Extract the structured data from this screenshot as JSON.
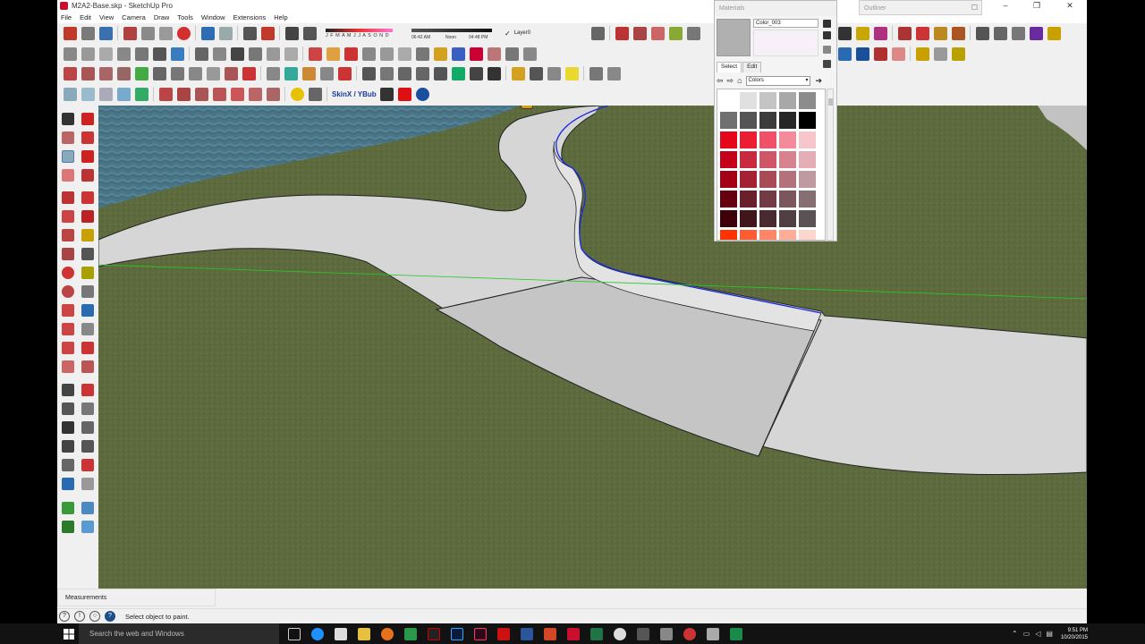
{
  "window": {
    "title": "M2A2-Base.skp - SketchUp Pro",
    "controls": [
      "–",
      "❐",
      "✕"
    ]
  },
  "menu": [
    "File",
    "Edit",
    "View",
    "Camera",
    "Draw",
    "Tools",
    "Window",
    "Extensions",
    "Help"
  ],
  "shadow_settings": {
    "months": "J F M A M J J A S O N D",
    "time_start": "06:42 AM",
    "time_noon": "Noon",
    "time_end": "04:48 PM"
  },
  "layer": {
    "current": "Layer0"
  },
  "extensions_toolbar": {
    "label": "SkinX / YBub"
  },
  "materials_panel": {
    "title": "Materials",
    "material_name": "Color_003",
    "tabs": [
      "Select",
      "Edit"
    ],
    "library": "Colors",
    "swatch_color": "#b0b0b0",
    "swatches": [
      "#ffffff",
      "#e0e0e0",
      "#c4c4c4",
      "#a8a8a8",
      "#8c8c8c",
      "#707070",
      "#555555",
      "#3c3c3c",
      "#262626",
      "#000000",
      "#e5061b",
      "#ec1c33",
      "#f05068",
      "#f58a9a",
      "#f9c5cd",
      "#c4001a",
      "#c9293f",
      "#d05568",
      "#d8828f",
      "#e3aeb6",
      "#a30015",
      "#a52233",
      "#ab4a57",
      "#b3727b",
      "#bf9aa0",
      "#660011",
      "#6b1f2b",
      "#733b44",
      "#7b575d",
      "#856f72",
      "#3d000b",
      "#42141b",
      "#492a30",
      "#513e42",
      "#5a5254",
      "#ff3300",
      "#ff5c33",
      "#ff8566",
      "#ffad99",
      "#ffd6cc"
    ]
  },
  "outliner_panel": {
    "title": "Outliner"
  },
  "status": {
    "measurements_label": "Measurements",
    "message": "Select object to paint."
  },
  "taskbar": {
    "search_placeholder": "Search the web and Windows",
    "time": "9:51 PM",
    "date": "10/20/2015"
  },
  "colors": {
    "water": "#4d7a8a",
    "grass": "#5d6a3d",
    "path": "#d9d9d9",
    "path_shadow": "#c2c2c2",
    "edge_highlight": "#1a2be0",
    "axis_green": "#28c828"
  }
}
